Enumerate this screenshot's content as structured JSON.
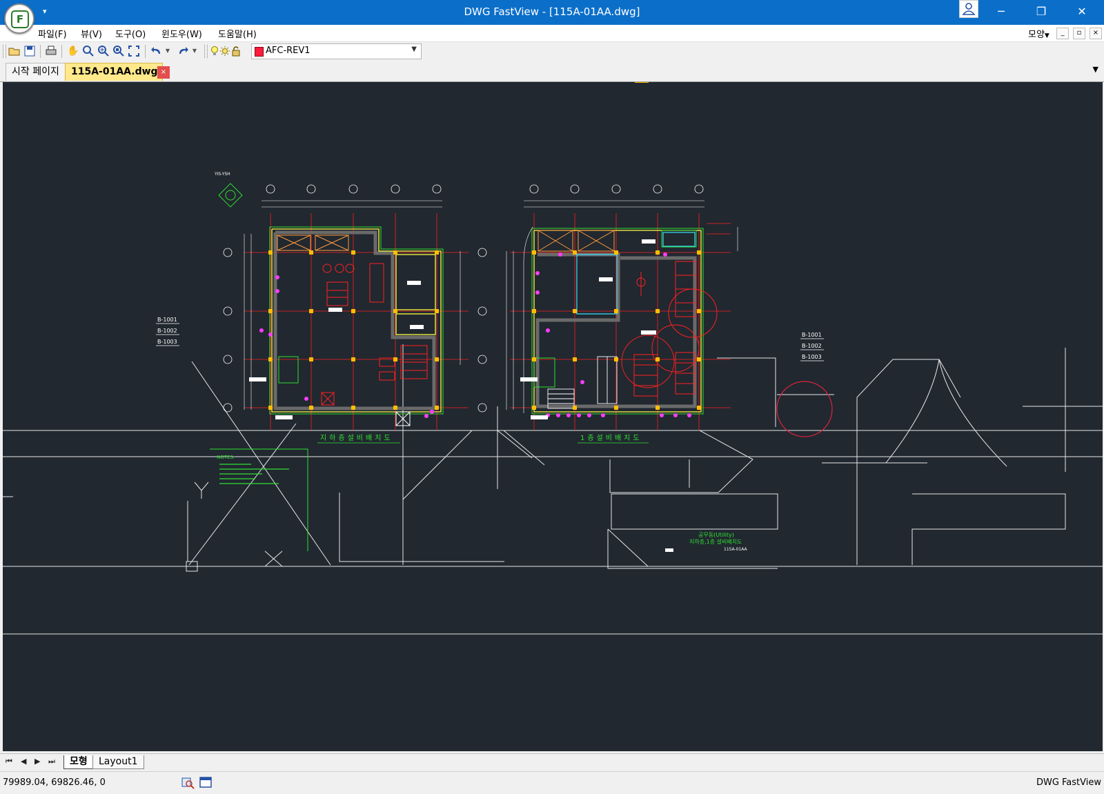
{
  "window": {
    "title": "DWG FastView - [115A-01AA.dwg]",
    "logo_letter": "F",
    "buttons": {
      "minimize": "─",
      "restore": "❐",
      "close": "✕"
    }
  },
  "menu": {
    "items": [
      "파일(F)",
      "뷰(V)",
      "도구(O)",
      "윈도우(W)",
      "도움말(H)"
    ],
    "style_label": "모양",
    "mdi_buttons": [
      "_",
      "▫",
      "×"
    ]
  },
  "toolbar": {
    "layer_name": "AFC-REV1",
    "layer_color": "#ff1a3d",
    "icons": [
      "open-icon",
      "save-icon",
      "print-icon",
      "pan-icon",
      "zoom-icon",
      "zoom-in-icon",
      "zoom-window-icon",
      "zoom-extents-icon",
      "undo-icon",
      "redo-icon",
      "layer-bulb-icon",
      "layer-sun-icon",
      "layer-lock-icon"
    ]
  },
  "tabs": {
    "start": "시작 페이지",
    "active": "115A-01AA.dwg",
    "close": "×",
    "list_arrow": "▼"
  },
  "drawing": {
    "left_title": "지하층설비배치도",
    "right_title": "1층설비배치도",
    "center_title_1": "공무동(Utility)",
    "center_title_2": "지하층,1층 설비배치도",
    "drawing_number": "115A-01AA",
    "notes_header": "NOTES:",
    "section_labels_left": [
      "B-1001",
      "B-1002",
      "B-1003"
    ],
    "section_labels_right": [
      "B-1001",
      "B-1002",
      "B-1003"
    ],
    "north_label": "YIS-YSH"
  },
  "layout_tabs": {
    "nav": [
      "⏮",
      "◀",
      "▶",
      "⏭"
    ],
    "model": "모형",
    "layout1": "Layout1"
  },
  "status": {
    "coordinates": "79989.04, 69826.46, 0",
    "brand": "DWG FastView"
  }
}
